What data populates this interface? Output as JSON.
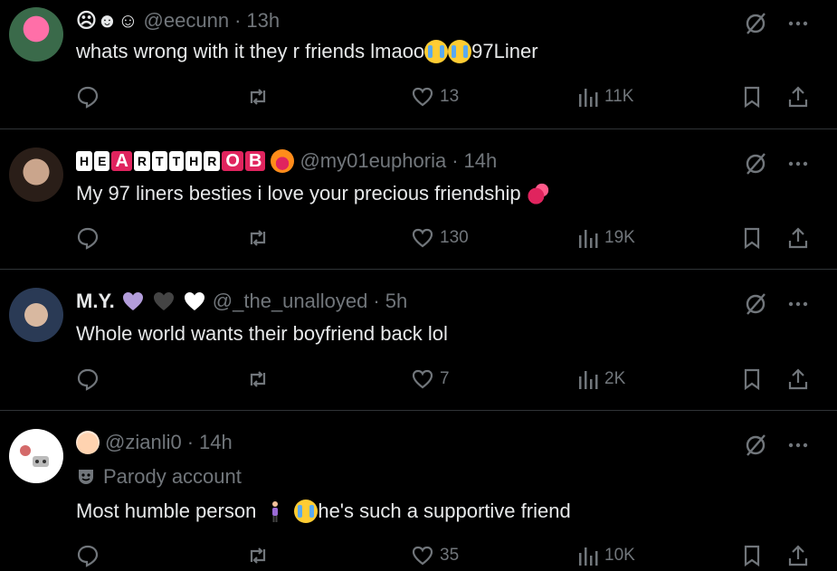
{
  "tweets": [
    {
      "display_name": "☹☻☺",
      "handle": "@eecunn",
      "time": "13h",
      "text_before": "whats wrong with it they r friends lmaoo",
      "text_after": "97Liner",
      "stats": {
        "likes": "13",
        "views": "11K"
      }
    },
    {
      "display_name_badges": [
        "H",
        "E",
        "A",
        "R",
        "T",
        "T",
        "H",
        "R",
        "O",
        "B"
      ],
      "handle": "@my01euphoria",
      "time": "14h",
      "text": "My 97 liners besties i love your precious friendship",
      "stats": {
        "likes": "130",
        "views": "19K"
      }
    },
    {
      "display_name": "M.Y.",
      "handle": "@_the_unalloyed",
      "time": "5h",
      "text": "Whole world wants their boyfriend back lol",
      "stats": {
        "likes": "7",
        "views": "2K"
      }
    },
    {
      "handle": "@zianli0",
      "time": "14h",
      "account_label": "Parody account",
      "text_before": "Most humble person",
      "text_after": "he's such a supportive friend",
      "stats": {
        "likes": "35",
        "views": "10K"
      }
    }
  ],
  "colors": {
    "background": "#000000",
    "text": "#e7e9ea",
    "muted": "#71767b",
    "divider": "#2f3336",
    "badge_red": "#e0245e"
  }
}
